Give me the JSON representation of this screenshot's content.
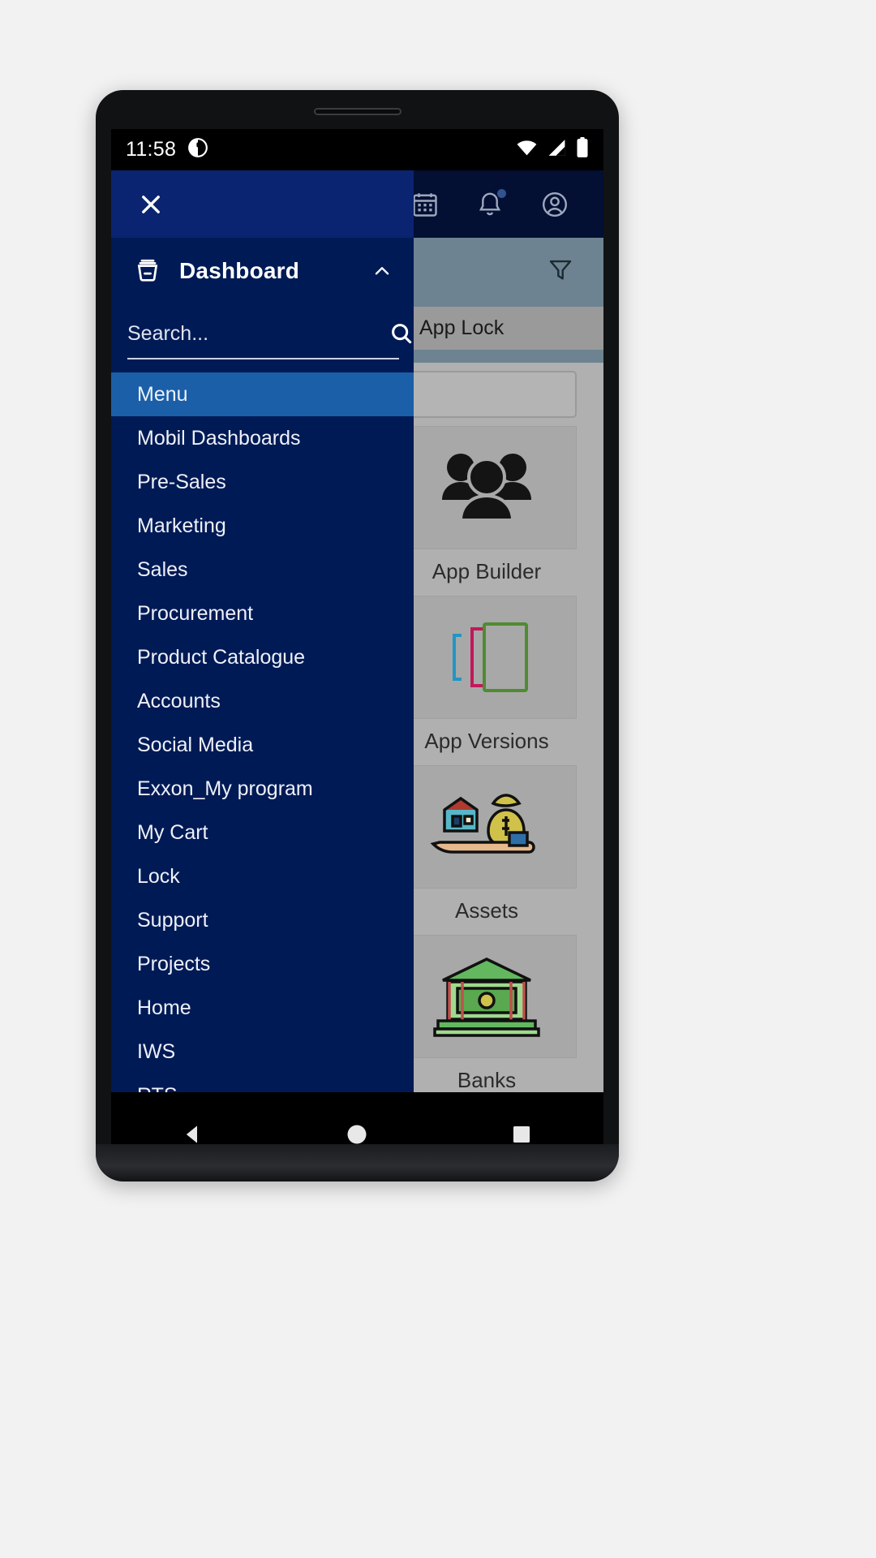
{
  "status_bar": {
    "time": "11:58",
    "left_icons": [
      "app-badge-icon"
    ],
    "right_icons": [
      "wifi-icon",
      "cellular-signal-icon",
      "battery-icon"
    ]
  },
  "app_background": {
    "topbar_icons": [
      "calendar-icon",
      "notifications-bell-icon",
      "account-circle-icon"
    ],
    "has_notification_dot": true,
    "filter_icon": "filter-funnel-icon",
    "chip_label": "App Lock",
    "search_placeholder": "",
    "tiles": [
      {
        "label": "App Builder",
        "icon": "people-group-icon"
      },
      {
        "label": "App Versions",
        "icon": "brackets-frames-icon"
      },
      {
        "label": "Assets",
        "icon": "house-money-hand-icon"
      },
      {
        "label": "Banks",
        "icon": "bank-building-icon"
      }
    ]
  },
  "drawer": {
    "close_icon": "close-x-icon",
    "title": "Dashboard",
    "title_icon": "dashboard-basket-icon",
    "collapse_icon": "chevron-up-icon",
    "search": {
      "value": "",
      "placeholder": "Search...",
      "icon": "search-magnifier-icon"
    },
    "items": [
      {
        "label": "Menu",
        "active": true
      },
      {
        "label": "Mobil Dashboards",
        "active": false
      },
      {
        "label": "Pre-Sales",
        "active": false
      },
      {
        "label": "Marketing",
        "active": false
      },
      {
        "label": "Sales",
        "active": false
      },
      {
        "label": "Procurement",
        "active": false
      },
      {
        "label": "Product Catalogue",
        "active": false
      },
      {
        "label": "Accounts",
        "active": false
      },
      {
        "label": "Social Media",
        "active": false
      },
      {
        "label": "Exxon_My program",
        "active": false
      },
      {
        "label": "My Cart",
        "active": false
      },
      {
        "label": "Lock",
        "active": false
      },
      {
        "label": "Support",
        "active": false
      },
      {
        "label": "Projects",
        "active": false
      },
      {
        "label": "Home",
        "active": false
      },
      {
        "label": "IWS",
        "active": false
      },
      {
        "label": "RTS",
        "active": false
      }
    ]
  },
  "nav_bar": {
    "buttons": [
      "back-triangle-icon",
      "home-circle-icon",
      "recents-square-icon"
    ]
  },
  "colors": {
    "drawer_navy": "#001a55",
    "drawer_head_navy": "#0a2472",
    "active_blue": "#1a5fa8",
    "topbar_navy": "#030f33",
    "subheader_slate": "#6d8391",
    "tiles_grey": "#b0b0b0"
  }
}
